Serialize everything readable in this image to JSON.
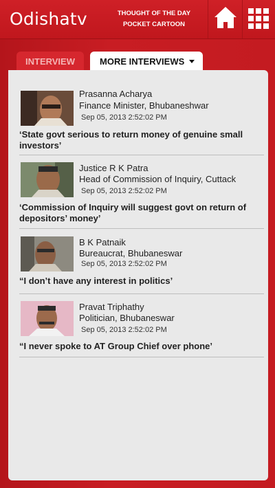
{
  "header": {
    "logo": "Odishatv",
    "links": [
      "THOUGHT OF THE DAY",
      "POCKET CARTOON"
    ],
    "home_icon": "home-icon",
    "menu_icon": "grid-menu-icon",
    "bar_color": "#c81d23"
  },
  "tabs": {
    "interview": "INTERVIEW",
    "more_interviews": "MORE INTERVIEWS"
  },
  "interviews": [
    {
      "name": "Prasanna Acharya",
      "role": "Finance Minister, Bhubaneshwar",
      "date": "Sep 05, 2013 2:52:02 PM",
      "quote": "‘State govt serious to return money of genuine small investors’"
    },
    {
      "name": "Justice R K Patra",
      "role": "Head of Commission of Inquiry, Cuttack",
      "date": "Sep 05, 2013 2:52:02 PM",
      "quote": "‘Commission of Inquiry will suggest govt on return of depositors’ money’"
    },
    {
      "name": "B K Patnaik",
      "role": "Bureaucrat, Bhubaneswar",
      "date": "Sep 05, 2013 2:52:02 PM",
      "quote": "“I don’t have any interest in politics’"
    },
    {
      "name": "Pravat Triphathy",
      "role": "Politician, Bhubaneswar",
      "date": "Sep 05, 2013 2:52:02 PM",
      "quote": "“I never spoke to AT Group Chief over phone’"
    }
  ]
}
